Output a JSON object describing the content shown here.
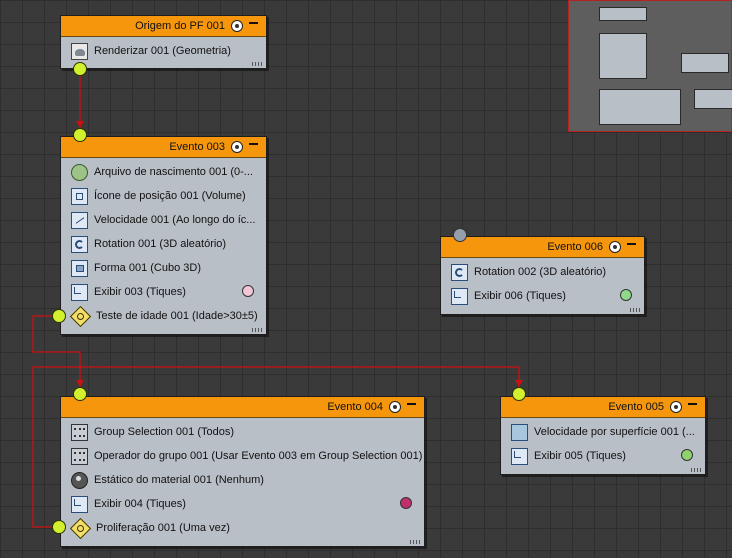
{
  "nodes": {
    "origin": {
      "title": "Origem do PF 001",
      "operators": [
        {
          "label": "Renderizar 001 (Geometria)",
          "icon": "render-icon"
        }
      ]
    },
    "event003": {
      "title": "Evento 003",
      "operators": [
        {
          "label": "Arquivo de nascimento 001 (0-...",
          "icon": "birth-icon"
        },
        {
          "label": "Ícone de posição 001 (Volume)",
          "icon": "position-icon"
        },
        {
          "label": "Velocidade 001 (Ao longo do íc...",
          "icon": "speed-icon"
        },
        {
          "label": "Rotation 001 (3D aleatório)",
          "icon": "rotation-icon"
        },
        {
          "label": "Forma 001 (Cubo 3D)",
          "icon": "shape-icon"
        },
        {
          "label": "Exibir 003 (Tiques)",
          "icon": "display-icon",
          "swatch_color": "#f2c6d6"
        },
        {
          "label": "Teste de idade 001 (Idade>30±5)",
          "icon": "test-icon"
        }
      ]
    },
    "event006": {
      "title": "Evento 006",
      "operators": [
        {
          "label": "Rotation 002 (3D aleatório)",
          "icon": "rotation-icon"
        },
        {
          "label": "Exibir 006 (Tiques)",
          "icon": "display-icon",
          "swatch_color": "#8fd98a"
        }
      ]
    },
    "event004": {
      "title": "Evento 004",
      "operators": [
        {
          "label": "Group Selection 001 (Todos)",
          "icon": "group-icon"
        },
        {
          "label": "Operador do grupo 001 (Usar Evento 003 em Group Selection 001)",
          "icon": "group-icon"
        },
        {
          "label": "Estático do material 001 (Nenhum)",
          "icon": "material-icon"
        },
        {
          "label": "Exibir 004 (Tiques)",
          "icon": "display-icon",
          "swatch_color": "#c0306f"
        },
        {
          "label": "Proliferação 001 (Uma vez)",
          "icon": "test-icon"
        }
      ]
    },
    "event005": {
      "title": "Evento 005",
      "operators": [
        {
          "label": "Velocidade por superfície 001 (...",
          "icon": "surface-speed-icon"
        },
        {
          "label": "Exibir 005 (Tiques)",
          "icon": "display-icon",
          "swatch_color": "#8fd36d"
        }
      ]
    }
  },
  "colors": {
    "header": "#f5960d",
    "node_body": "#b9bfc7",
    "port_active": "#d2f02e",
    "wire": "#cc1111",
    "background": "#3a3a3a"
  }
}
